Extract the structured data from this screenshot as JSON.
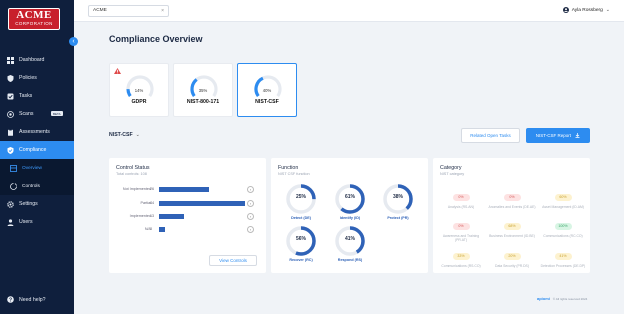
{
  "brand": {
    "logo_top": "ACME",
    "logo_bottom": "CORPORATION",
    "footer_brand": "apiomi",
    "footer_copy": "© All rights reserved 2024"
  },
  "colors": {
    "sidebar": "#0f1f3d",
    "accent": "#2d8cf0",
    "bar": "#2f62b7",
    "warn": "#e04b4b"
  },
  "topbar": {
    "org_value": "ACME",
    "user_name": "Ayla Rossberg"
  },
  "sidebar": {
    "items": [
      {
        "label": "Dashboard",
        "icon": "grid-icon"
      },
      {
        "label": "Policies",
        "icon": "shield-icon"
      },
      {
        "label": "Tasks",
        "icon": "tasks-icon"
      },
      {
        "label": "Scans",
        "icon": "radar-icon",
        "badge": "BETA"
      },
      {
        "label": "Assessments",
        "icon": "clipboard-icon"
      },
      {
        "label": "Compliance",
        "icon": "compliance-icon"
      }
    ],
    "sub_items": [
      {
        "label": "Overview",
        "icon": "overview-icon"
      },
      {
        "label": "Controls",
        "icon": "controls-icon"
      }
    ],
    "bottom_items": [
      {
        "label": "Settings",
        "icon": "gear-icon"
      },
      {
        "label": "Users",
        "icon": "users-icon"
      }
    ],
    "help": "Need help?"
  },
  "main": {
    "title": "Compliance Overview",
    "frameworks": [
      {
        "name": "GDPR",
        "percent": 14,
        "percent_label": "14%",
        "warning": true
      },
      {
        "name": "NIST-800-171",
        "percent": 35,
        "percent_label": "35%",
        "warning": false
      },
      {
        "name": "NIST-CSF",
        "percent": 40,
        "percent_label": "40%",
        "warning": false,
        "selected": true
      }
    ],
    "framework_select": "NIST-CSF",
    "related_tasks_label": "Related Open Tasks",
    "report_label": "NIST-CSF Report",
    "control_status": {
      "title": "Control Status",
      "subtitle": "Total controls: 108",
      "rows": [
        {
          "label": "Not Implemented",
          "count": 26,
          "fraction": 0.24
        },
        {
          "label": "Partial",
          "count": 44,
          "fraction": 0.41
        },
        {
          "label": "Implemented",
          "count": 13,
          "fraction": 0.12
        },
        {
          "label": "N/A",
          "count": 3,
          "fraction": 0.03
        }
      ],
      "view_label": "View Controls"
    },
    "function": {
      "title": "Function",
      "subtitle": "NIST CSF function",
      "items": [
        {
          "label": "Detect (DE)",
          "percent": 25,
          "percent_label": "25%"
        },
        {
          "label": "Identify (ID)",
          "percent": 61,
          "percent_label": "61%"
        },
        {
          "label": "Protect (PR)",
          "percent": 38,
          "percent_label": "38%"
        },
        {
          "label": "Recover (RC)",
          "percent": 56,
          "percent_label": "56%"
        },
        {
          "label": "Respond (RS)",
          "percent": 41,
          "percent_label": "41%"
        }
      ]
    },
    "category": {
      "title": "Category",
      "subtitle": "NIST category",
      "items": [
        {
          "value": "0%",
          "label": "Analysis (RS.AN)",
          "tone": "red"
        },
        {
          "value": "0%",
          "label": "Anomalies and Events (DE.AE)",
          "tone": "red"
        },
        {
          "value": "60%",
          "label": "Asset Management (ID.AM)",
          "tone": "yellow"
        },
        {
          "value": "0%",
          "label": "Awareness and Training (PR.AT)",
          "tone": "red"
        },
        {
          "value": "68%",
          "label": "Business Environment (ID.BE)",
          "tone": "yellow"
        },
        {
          "value": "100%",
          "label": "Communications (RC.CO)",
          "tone": "green"
        },
        {
          "value": "33%",
          "label": "Communications (RS.CO)",
          "tone": "yellow"
        },
        {
          "value": "20%",
          "label": "Data Security (PR.DS)",
          "tone": "yellow"
        },
        {
          "value": "41%",
          "label": "Detection Processes (DE.DP)",
          "tone": "yellow"
        }
      ]
    }
  }
}
